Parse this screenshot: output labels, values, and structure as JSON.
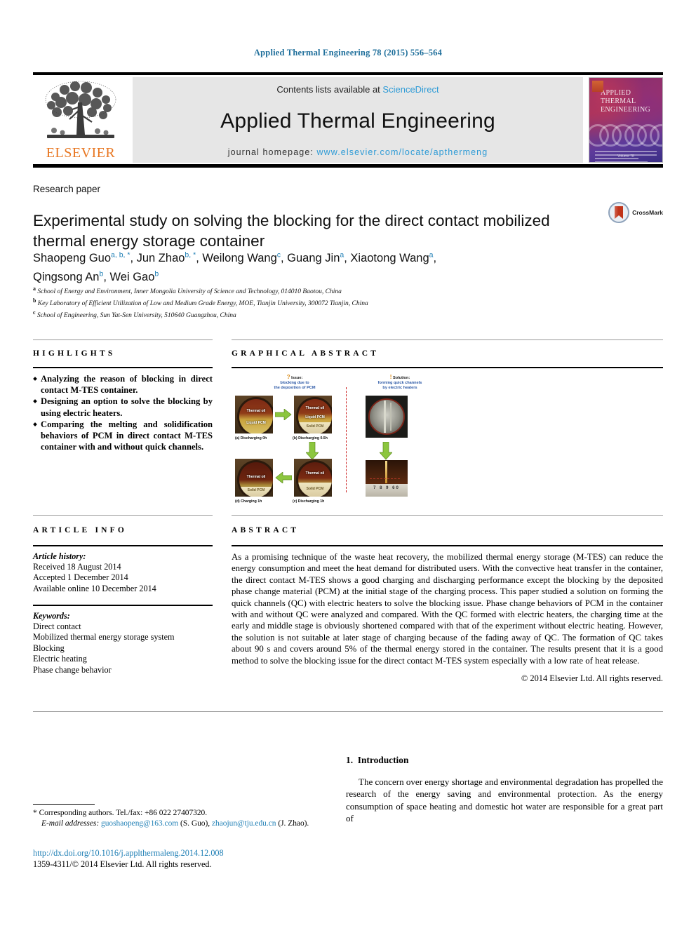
{
  "running_head": "Applied Thermal Engineering 78 (2015) 556–564",
  "masthead": {
    "contents_prefix": "Contents lists available at",
    "sciencedirect": "ScienceDirect",
    "journal_title": "Applied Thermal Engineering",
    "homepage_prefix": "journal homepage:",
    "homepage_url": "www.elsevier.com/locate/apthermeng",
    "publisher": "ELSEVIER",
    "cover_title_line1": "APPLIED",
    "cover_title_line2": "THERMAL",
    "cover_title_line3": "ENGINEERING",
    "cover_footer": "Volume 78"
  },
  "article": {
    "type": "Research paper",
    "title": "Experimental study on solving the blocking for the direct contact mobilized thermal energy storage container",
    "crossmark_label": "CrossMark",
    "authors_line1": "Shaopeng Guo a, b, *, Jun Zhao b, *, Weilong Wang c, Guang Jin a, Xiaotong Wang a,",
    "authors_line2": "Qingsong An b, Wei Gao b",
    "authors": [
      {
        "name": "Shaopeng Guo",
        "marks": "a, b, *"
      },
      {
        "name": "Jun Zhao",
        "marks": "b, *"
      },
      {
        "name": "Weilong Wang",
        "marks": "c"
      },
      {
        "name": "Guang Jin",
        "marks": "a"
      },
      {
        "name": "Xiaotong Wang",
        "marks": "a"
      },
      {
        "name": "Qingsong An",
        "marks": "b"
      },
      {
        "name": "Wei Gao",
        "marks": "b"
      }
    ],
    "affiliations": [
      {
        "mark": "a",
        "text": "School of Energy and Environment, Inner Mongolia University of Science and Technology, 014010 Baotou, China"
      },
      {
        "mark": "b",
        "text": "Key Laboratory of Efficient Utilization of Low and Medium Grade Energy, MOE, Tianjin University, 300072 Tianjin, China"
      },
      {
        "mark": "c",
        "text": "School of Engineering, Sun Yat-Sen University, 510640 Guangzhou, China"
      }
    ]
  },
  "highlights": {
    "heading": "HIGHLIGHTS",
    "items": [
      "Analyzing the reason of blocking in direct contact M-TES container.",
      "Designing an option to solve the blocking by using electric heaters.",
      "Comparing the melting and solidification behaviors of PCM in direct contact M-TES container with and without quick channels."
    ]
  },
  "graphical_abstract": {
    "heading": "GRAPHICAL ABSTRACT",
    "issue_marker": "?",
    "issue_title": "Issue:",
    "issue_text_line1": "blocking due to",
    "issue_text_line2": "the deposition of PCM",
    "solution_marker": "!",
    "solution_title": "Solution:",
    "solution_text_line1": "forming quick channels",
    "solution_text_line2": "by electric heaters",
    "panels": [
      {
        "caption": "(a) Discharging 0h",
        "top_text": "Thermal oil",
        "bottom_text": "Liquid PCM"
      },
      {
        "caption": "(b) Discharging 0.5h",
        "top_text": "Thermal oil",
        "mid_text": "Liquid PCM",
        "bottom_text": "Solid PCM"
      },
      {
        "caption": "(c) Discharging 1h",
        "top_text": "Thermal oil",
        "bottom_text": "Solid PCM"
      },
      {
        "caption": "(d) Charging 1h",
        "top_text": "Thermal oil",
        "bottom_text": "Solid PCM"
      }
    ],
    "ruler_digits": "7 8 9 60"
  },
  "article_info": {
    "heading": "ARTICLE INFO",
    "history_label": "Article history:",
    "history": [
      "Received 18 August 2014",
      "Accepted 1 December 2014",
      "Available online 10 December 2014"
    ],
    "keywords_label": "Keywords:",
    "keywords": [
      "Direct contact",
      "Mobilized thermal energy storage system",
      "Blocking",
      "Electric heating",
      "Phase change behavior"
    ]
  },
  "abstract": {
    "heading": "ABSTRACT",
    "text": "As a promising technique of the waste heat recovery, the mobilized thermal energy storage (M-TES) can reduce the energy consumption and meet the heat demand for distributed users. With the convective heat transfer in the container, the direct contact M-TES shows a good charging and discharging performance except the blocking by the deposited phase change material (PCM) at the initial stage of the charging process. This paper studied a solution on forming the quick channels (QC) with electric heaters to solve the blocking issue. Phase change behaviors of PCM in the container with and without QC were analyzed and compared. With the QC formed with electric heaters, the charging time at the early and middle stage is obviously shortened compared with that of the experiment without electric heating. However, the solution is not suitable at later stage of charging because of the fading away of QC. The formation of QC takes about 90 s and covers around 5% of the thermal energy stored in the container. The results present that it is a good method to solve the blocking issue for the direct contact M-TES system especially with a low rate of heat release.",
    "copyright": "© 2014 Elsevier Ltd. All rights reserved."
  },
  "body": {
    "section_number": "1.",
    "section_title": "Introduction",
    "paragraph": "The concern over energy shortage and environmental degradation has propelled the research of the energy saving and environmental protection. As the energy consumption of space heating and domestic hot water are responsible for a great part of"
  },
  "footnotes": {
    "corresponding_marker": "*",
    "corresponding_text": "Corresponding authors. Tel./fax: +86 022 27407320.",
    "email_label": "E-mail addresses:",
    "email1": "guoshaopeng@163.com",
    "email1_owner": "(S. Guo),",
    "email2": "zhaojun@tju.edu.cn",
    "email2_owner": "(J. Zhao).",
    "doi": "http://dx.doi.org/10.1016/j.applthermaleng.2014.12.008",
    "issn_line": "1359-4311/© 2014 Elsevier Ltd. All rights reserved."
  },
  "colors": {
    "link_blue": "#1f7fb5",
    "sciencedirect_blue": "#2e9bd6",
    "elsevier_orange": "#E87722",
    "crossmark_red": "#c0341a",
    "arrow_green": "#8cc63e"
  }
}
